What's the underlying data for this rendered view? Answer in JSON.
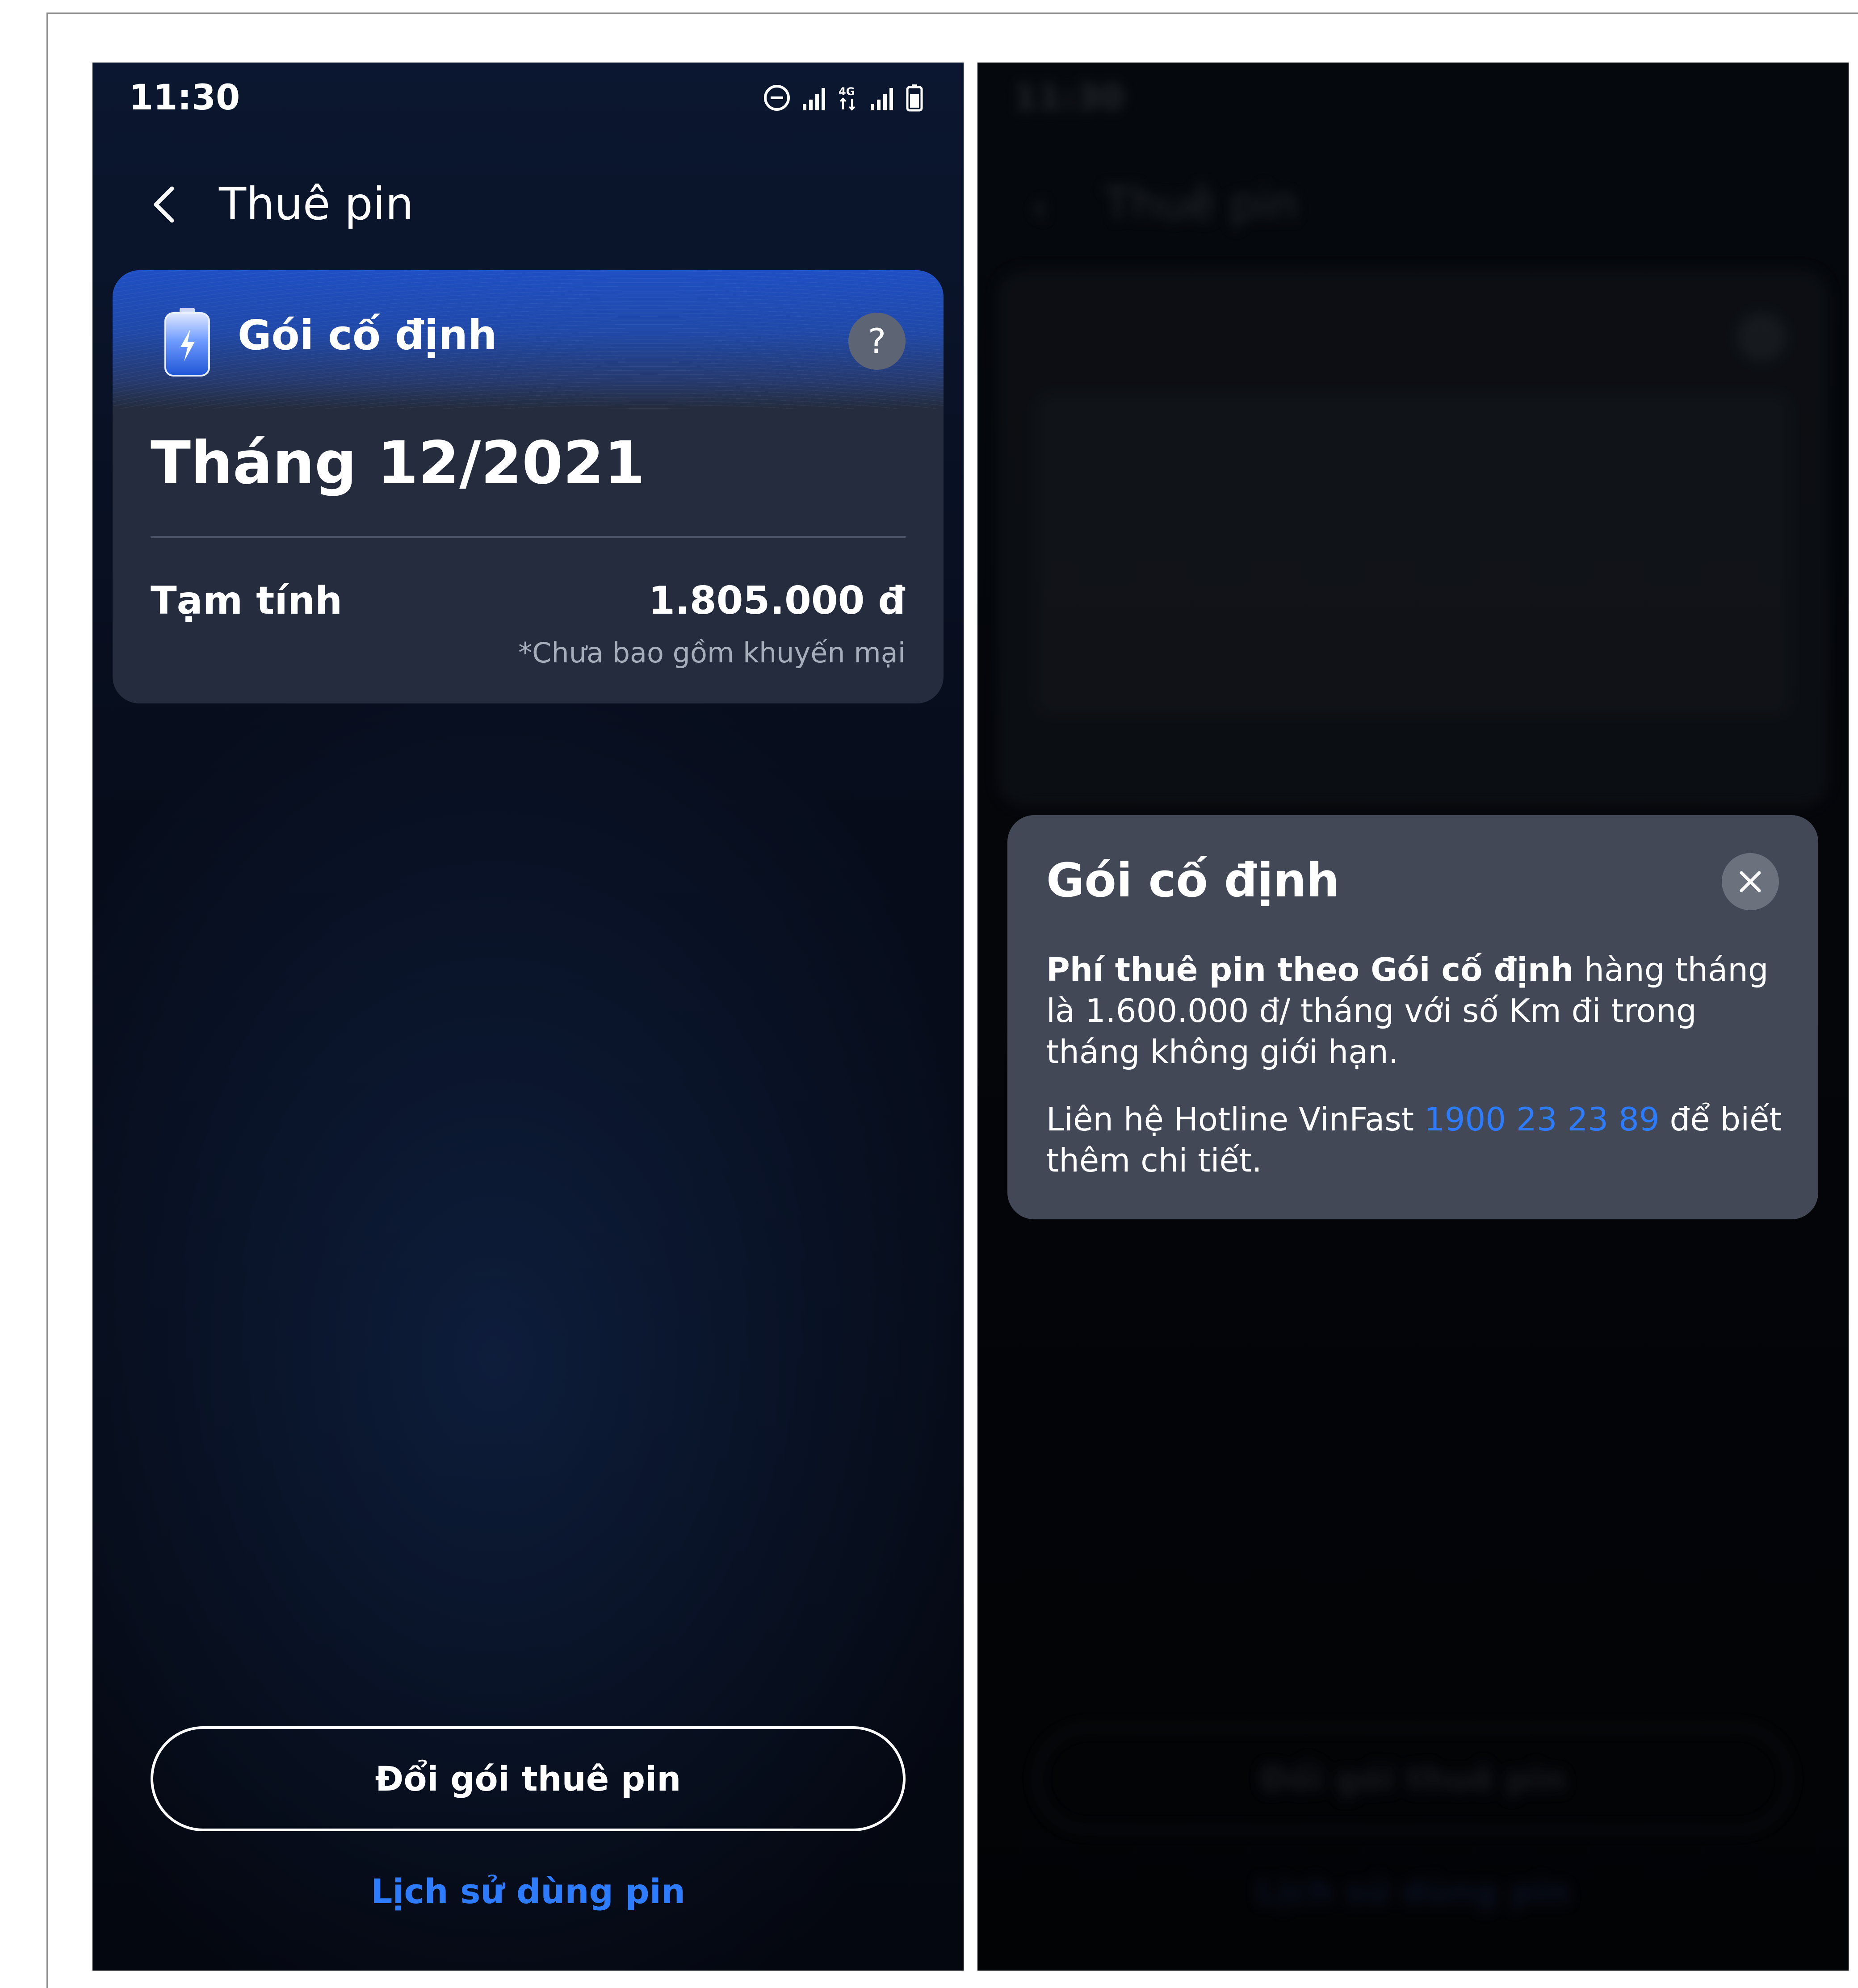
{
  "screen_left": {
    "status_bar": {
      "time": "11:30"
    },
    "header": {
      "title": "Thuê pin"
    },
    "plan_card": {
      "plan_name": "Gói cố định",
      "help_symbol": "?",
      "month_title": "Tháng 12/2021",
      "estimate_label": "Tạm tính",
      "estimate_amount": "1.805.000 đ",
      "estimate_note": "*Chưa bao gồm khuyến mại"
    },
    "actions": {
      "change_plan_label": "Đổi gói thuê pin",
      "history_link_label": "Lịch sử dùng pin"
    }
  },
  "screen_right": {
    "modal": {
      "title": "Gói cố định",
      "body_bold": "Phí thuê pin theo Gói cố định",
      "body_rest": " hàng tháng là 1.600.000 đ/ tháng với số Km đi trong tháng không giới hạn.",
      "contact_prefix": "Liên hệ Hotline VinFast ",
      "hotline": "1900 23 23 89",
      "contact_suffix": " để biết thêm chi tiết."
    }
  },
  "colors": {
    "accent_link": "#2d7bff",
    "card_header_blue": "#1f4fc4",
    "card_body": "#242c3d",
    "modal_bg": "#424855"
  },
  "icons": [
    "status-icons",
    "back-arrow-icon",
    "battery-charge-icon",
    "help-icon",
    "close-icon"
  ]
}
